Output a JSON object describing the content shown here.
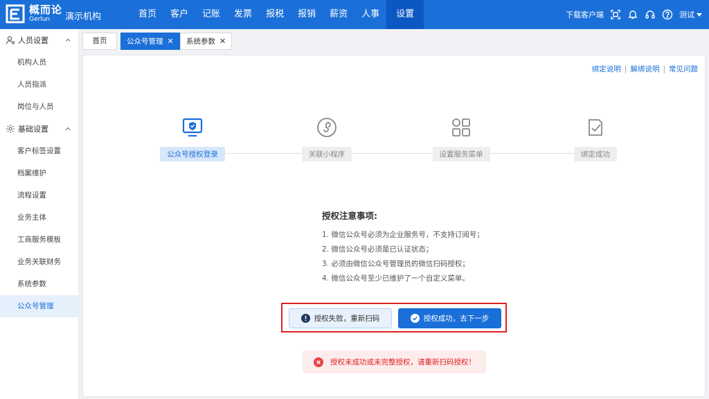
{
  "app": {
    "logo_cn": "概而论",
    "logo_en": "Gerlun",
    "org_name": "演示机构",
    "brand_color": "#1a6fd8"
  },
  "nav": [
    "首页",
    "客户",
    "记账",
    "发票",
    "报税",
    "报销",
    "薪资",
    "人事",
    "设置"
  ],
  "nav_active": "设置",
  "topright": {
    "download": "下载客户端",
    "user": "测试"
  },
  "sidebar": {
    "groups": [
      {
        "label": "人员设置",
        "icon": "user-settings-icon",
        "items": [
          "机构人员",
          "人员指派",
          "岗位与人员"
        ]
      },
      {
        "label": "基础设置",
        "icon": "gear-icon",
        "items": [
          "客户标签设置",
          "档案维护",
          "流程设置",
          "业务主体",
          "工商服务模板",
          "业务关联财务",
          "系统参数",
          "公众号管理"
        ]
      }
    ],
    "active_item": "公众号管理"
  },
  "tabs": [
    {
      "label": "首页",
      "closable": false
    },
    {
      "label": "公众号管理",
      "closable": true,
      "active": true
    },
    {
      "label": "系统参数",
      "closable": true
    }
  ],
  "help_links": [
    "绑定说明",
    "解绑说明",
    "常见问题"
  ],
  "steps": [
    {
      "label": "公众号授权登录",
      "icon": "monitor-shield-icon",
      "active": true
    },
    {
      "label": "关联小程序",
      "icon": "mini-program-icon",
      "active": false
    },
    {
      "label": "设置服务菜单",
      "icon": "grid-menu-icon",
      "active": false
    },
    {
      "label": "绑定成功",
      "icon": "clipboard-check-icon",
      "active": false
    }
  ],
  "notice": {
    "title": "授权注意事项:",
    "items": [
      "1. 微信公众号必须为企业服务号，不支持订阅号；",
      "2. 微信公众号必须是已认证状态；",
      "3. 必须由微信公众号管理员的微信扫码授权；",
      "4. 微信公众号至少已维护了一个自定义菜单。"
    ]
  },
  "buttons": {
    "fail": "授权失败，重新扫码",
    "success": "授权成功，去下一步"
  },
  "error_message": "授权未成功或未完整授权，请重新扫码授权！"
}
